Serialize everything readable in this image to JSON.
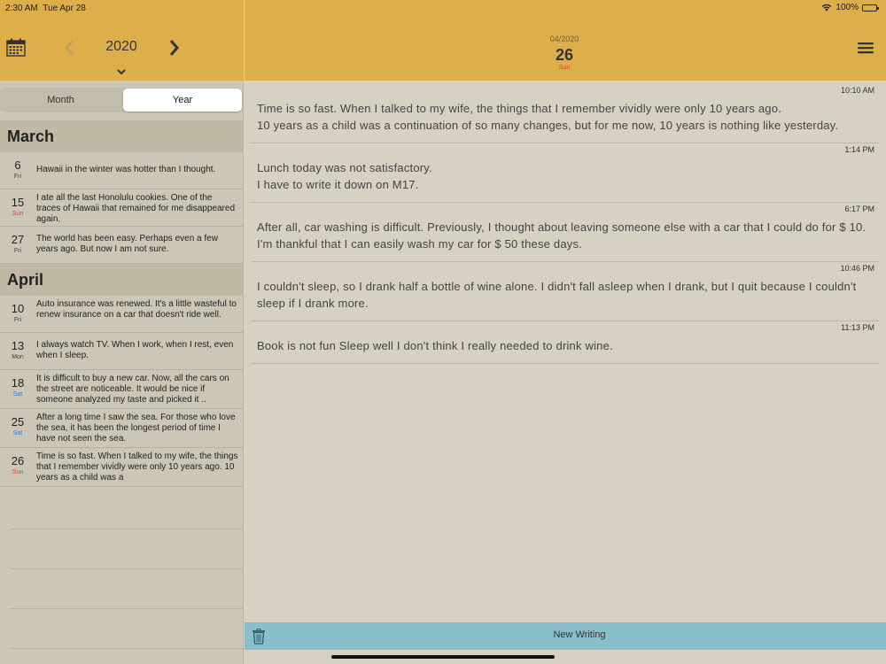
{
  "status": {
    "time": "2:30 AM",
    "date": "Tue Apr 28",
    "battery": "100%"
  },
  "sidebar": {
    "year": "2020",
    "prev_glyph": "‹",
    "next_glyph": "›",
    "tabs": {
      "month": "Month",
      "year": "Year"
    },
    "groups": [
      {
        "month": "March",
        "entries": [
          {
            "day": "6",
            "dow": "Fri",
            "text": "Hawaii in the winter was hotter than I thought."
          },
          {
            "day": "15",
            "dow": "Sun",
            "text": "I ate all the last Honolulu cookies. One of the traces of Hawaii that remained for me disappeared again."
          },
          {
            "day": "27",
            "dow": "Fri",
            "text": "The world has been easy. Perhaps even a few years ago. But now I am not sure."
          }
        ]
      },
      {
        "month": "April",
        "entries": [
          {
            "day": "10",
            "dow": "Fri",
            "text": "Auto insurance was renewed. It's a little wasteful to renew insurance on a car that doesn't ride well."
          },
          {
            "day": "13",
            "dow": "Mon",
            "text": "I always watch TV. When I work, when I rest, even when I sleep."
          },
          {
            "day": "18",
            "dow": "Sat",
            "text": "It is difficult to buy a new car. Now, all the cars on the street are noticeable. It would be nice if someone analyzed my taste and picked it .."
          },
          {
            "day": "25",
            "dow": "Sat",
            "text": "After a long time I saw the sea. For those who love the sea, it has been the longest period of time I have not seen the sea."
          },
          {
            "day": "26",
            "dow": "Sun",
            "text": "Time is so fast. When I talked to my wife, the things that I remember vividly were only 10 years ago. 10 years as a child was a"
          }
        ]
      }
    ]
  },
  "detail": {
    "month_year": "04/2020",
    "day": "26",
    "dow": "Sun",
    "entries": [
      {
        "time": "10:10 AM",
        "lines": [
          "Time is so fast. When I talked to my wife, the things that I remember vividly were only 10 years ago.",
          "10 years as a child was a continuation of so many changes, but for me now, 10 years is nothing like yesterday."
        ]
      },
      {
        "time": "1:14 PM",
        "lines": [
          "Lunch today was not satisfactory.",
          "I have to write it down on M17."
        ]
      },
      {
        "time": "6:17 PM",
        "lines": [
          "After all, car washing is difficult. Previously, I thought about leaving someone else with a car that I could do for $ 10. I'm thankful that I can easily wash my car for $ 50 these days."
        ]
      },
      {
        "time": "10:46 PM",
        "lines": [
          "I couldn't sleep, so I drank half a bottle of wine alone. I didn't fall asleep when I drank, but I quit because I couldn't sleep if I drank more."
        ]
      },
      {
        "time": "11:13 PM",
        "lines": [
          "Book is not fun Sleep well I don't think I really needed to drink wine."
        ]
      }
    ],
    "new_writing": "New Writing"
  }
}
